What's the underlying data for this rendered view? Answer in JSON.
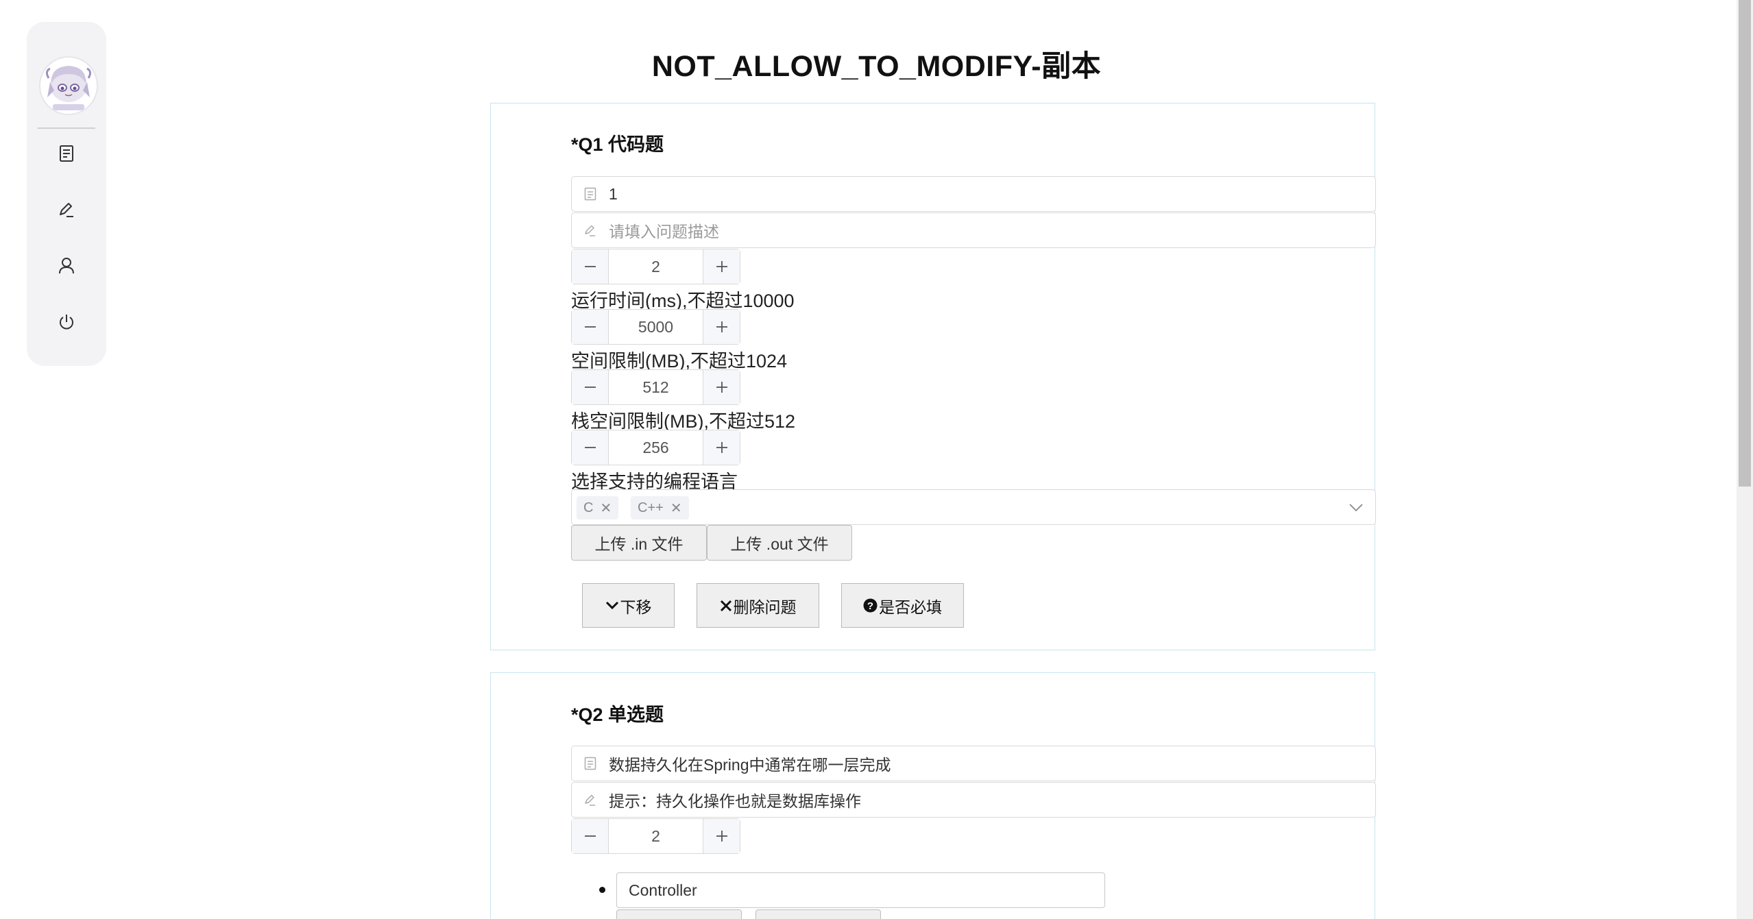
{
  "page": {
    "title": "NOT_ALLOW_TO_MODIFY-副本"
  },
  "sidebar": {
    "items": [
      {
        "icon": "document-icon"
      },
      {
        "icon": "edit-icon"
      },
      {
        "icon": "user-icon"
      },
      {
        "icon": "power-icon"
      }
    ]
  },
  "q1": {
    "title": "*Q1 代码题",
    "name_value": "1",
    "desc_placeholder": "请填入问题描述",
    "score": "2",
    "runtime_label": "运行时间(ms),不超过10000",
    "runtime": "5000",
    "memory_label": "空间限制(MB),不超过1024",
    "memory": "512",
    "stack_label": "栈空间限制(MB),不超过512",
    "stack": "256",
    "lang_label": "选择支持的编程语言",
    "languages": [
      "C",
      "C++"
    ],
    "upload_in": "上传 .in 文件",
    "upload_out": "上传 .out 文件",
    "move_down": "下移",
    "delete": "删除问题",
    "required": "是否必填"
  },
  "q2": {
    "title": "*Q2 单选题",
    "name_value": "数据持久化在Spring中通常在哪一层完成",
    "desc_value": "提示：持久化操作也就是数据库操作",
    "score": "2",
    "options": [
      "Controller"
    ]
  }
}
